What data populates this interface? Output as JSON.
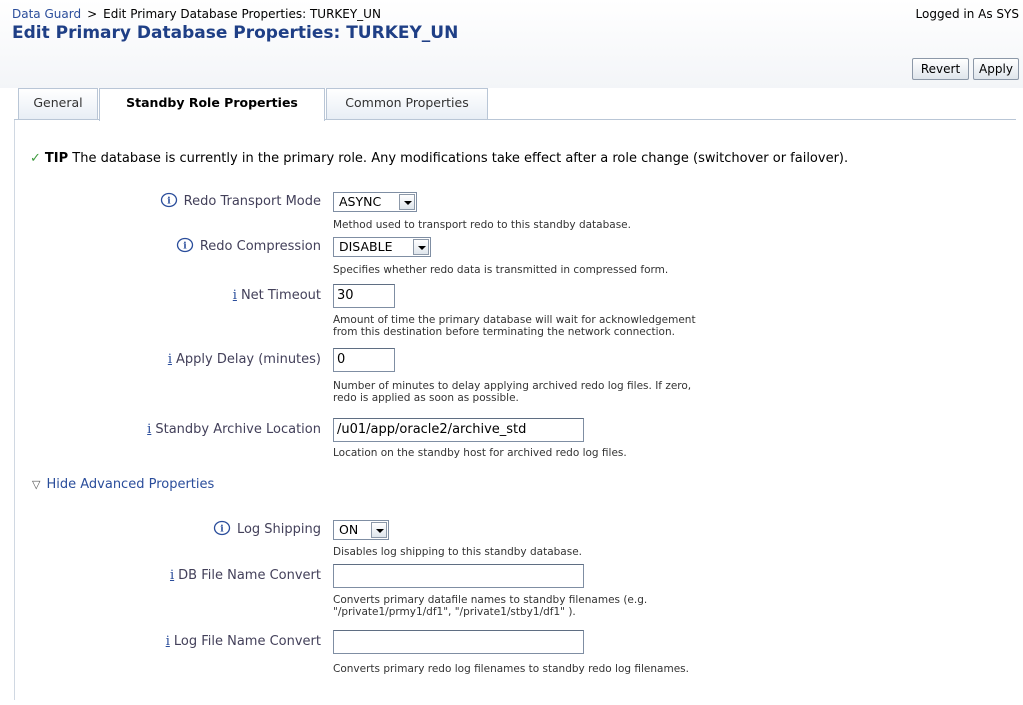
{
  "breadcrumb": {
    "root": "Data Guard",
    "separator": ">",
    "current": "Edit Primary Database Properties: TURKEY_UN"
  },
  "user_status": "Logged in As SYS",
  "page_title": "Edit Primary Database Properties: TURKEY_UN",
  "buttons": {
    "revert": "Revert",
    "apply": "Apply"
  },
  "tabs": [
    {
      "label": "General",
      "active": false
    },
    {
      "label": "Standby Role Properties",
      "active": true
    },
    {
      "label": "Common Properties",
      "active": false
    }
  ],
  "tip": {
    "icon": "check-icon",
    "label": "TIP",
    "text": "The database is currently in the primary role. Any modifications take effect after a role change (switchover or failover)."
  },
  "fields": {
    "redo_transport_mode": {
      "label": "Redo Transport Mode",
      "value": "ASYNC",
      "help": "Method used to transport redo to this standby database."
    },
    "redo_compression": {
      "label": "Redo Compression",
      "value": "DISABLE",
      "help": "Specifies whether redo data is transmitted in compressed form."
    },
    "net_timeout": {
      "info": "i",
      "label": "Net Timeout",
      "value": "30",
      "help_1": "Amount of time the primary database will wait for acknowledgement",
      "help_2": "from this destination before terminating the network connection."
    },
    "apply_delay": {
      "info": "i",
      "label": "Apply Delay (minutes)",
      "value": "0",
      "help_1": "Number of minutes to delay applying archived redo log files. If zero,",
      "help_2": "redo is applied as soon as possible."
    },
    "standby_archive_location": {
      "info": "i",
      "label": "Standby Archive Location",
      "value": "/u01/app/oracle2/archive_std",
      "help": "Location on the standby host for archived redo log files."
    }
  },
  "advanced_toggle": "Hide Advanced Properties",
  "advanced": {
    "log_shipping": {
      "label": "Log Shipping",
      "value": "ON",
      "help": "Disables log shipping to this standby database."
    },
    "db_file_name_convert": {
      "info": "i",
      "label": "DB File Name Convert",
      "value": "",
      "help_1": "Converts primary datafile names to standby filenames (e.g.",
      "help_2": "\"/private1/prmy1/df1\", \"/private1/stby1/df1\" )."
    },
    "log_file_name_convert": {
      "info": "i",
      "label": "Log File Name Convert",
      "value": "",
      "help": "Converts primary redo log filenames to standby redo log filenames."
    }
  },
  "colors": {
    "link": "#2a4d9b",
    "title": "#1f3f86",
    "label": "#43405a",
    "tip_check": "#3f9b3f"
  }
}
